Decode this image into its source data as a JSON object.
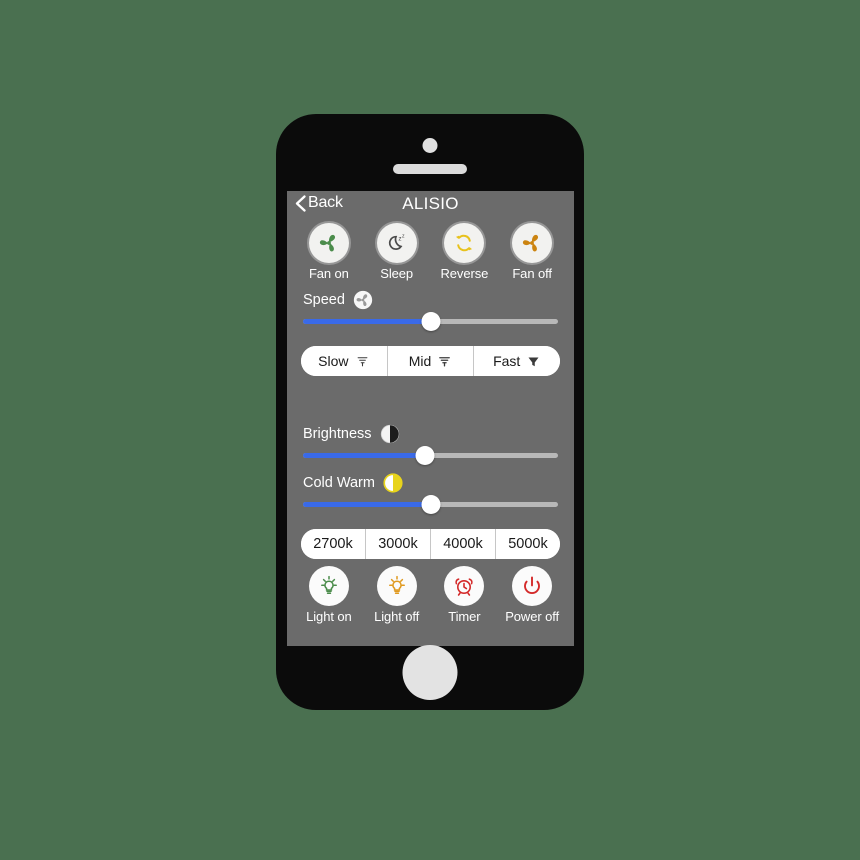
{
  "device": {
    "frame": "smartphone",
    "camera": "camera-dot",
    "speaker": "earpiece-speaker",
    "home_button": "home-button"
  },
  "nav": {
    "back_label": "Back",
    "back_icon": "chevron-left-icon",
    "title": "ALISIO"
  },
  "fan_controls": [
    {
      "label": "Fan on",
      "icon": "fan-icon",
      "color": "#4b8c4b"
    },
    {
      "label": "Sleep",
      "icon": "moon-zzz-icon",
      "color": "#4a4a4a"
    },
    {
      "label": "Reverse",
      "icon": "refresh-loop-icon",
      "color": "#e8c21c"
    },
    {
      "label": "Fan off",
      "icon": "fan-icon",
      "color": "#cc8410"
    }
  ],
  "speed": {
    "label": "Speed",
    "icon": "fan-icon",
    "icon_color": "#9a9a9a",
    "value_percent": 50,
    "fill_color": "#3a6ae8",
    "track_color": "#b8b8b8"
  },
  "speed_presets": [
    {
      "label": "Slow",
      "icon": "wind-light-icon"
    },
    {
      "label": "Mid",
      "icon": "wind-medium-icon"
    },
    {
      "label": "Fast",
      "icon": "wind-strong-icon"
    }
  ],
  "brightness": {
    "label": "Brightness",
    "icon": "half-circle-icon",
    "icon_color": "#1c1c1c",
    "value_percent": 48,
    "fill_color": "#3a6ae8",
    "track_color": "#b8b8b8"
  },
  "cold_warm": {
    "label": "Cold Warm",
    "icon": "half-circle-warm-icon",
    "icon_color": "#e8d41c",
    "value_percent": 50,
    "fill_color": "#3a6ae8",
    "track_color": "#b8b8b8"
  },
  "color_temperatures": [
    {
      "label": "2700k"
    },
    {
      "label": "3000k"
    },
    {
      "label": "4000k"
    },
    {
      "label": "5000k"
    }
  ],
  "light_controls": [
    {
      "label": "Light on",
      "icon": "bulb-on-icon",
      "color": "#4b8c4b"
    },
    {
      "label": "Light off",
      "icon": "bulb-off-icon",
      "color": "#e09a20"
    },
    {
      "label": "Timer",
      "icon": "alarm-clock-icon",
      "color": "#d42a2a"
    },
    {
      "label": "Power off",
      "icon": "power-icon",
      "color": "#d42a2a"
    }
  ],
  "theme": {
    "page_background": "#4a7050",
    "screen_background": "#6b6b6b",
    "frame_color": "#0b0b0b",
    "text_color": "#ffffff"
  }
}
